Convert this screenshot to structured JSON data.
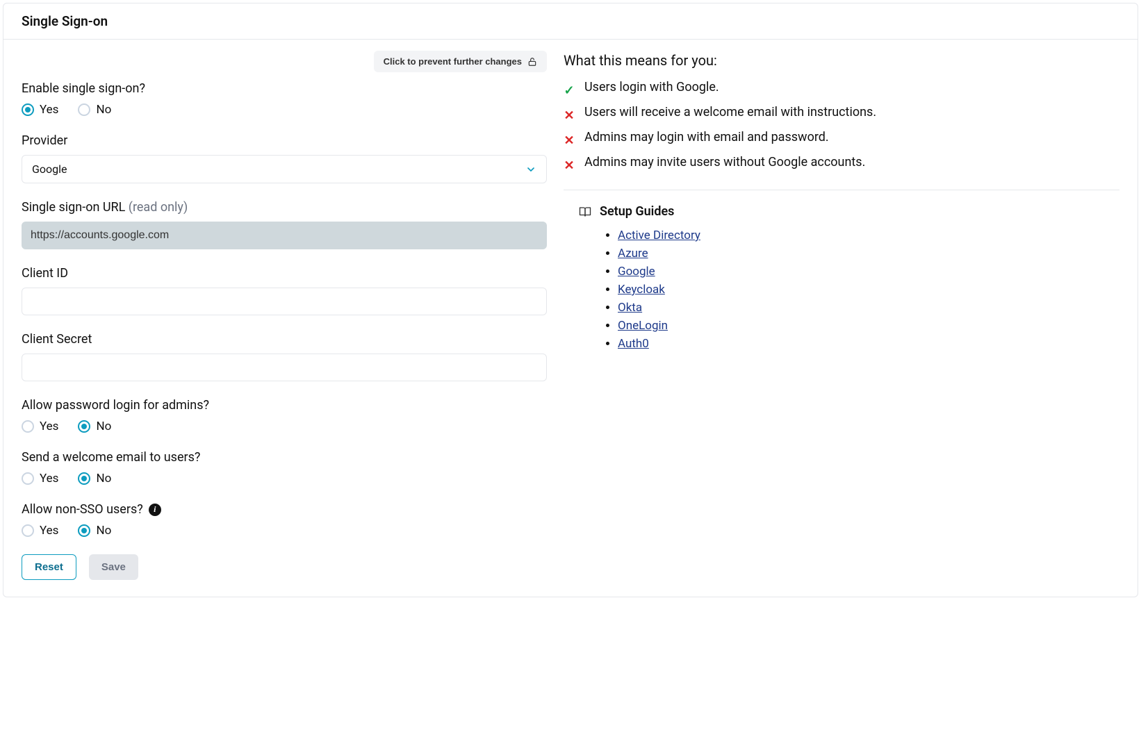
{
  "header": {
    "title": "Single Sign-on"
  },
  "lock_button": {
    "label": "Click to prevent further changes"
  },
  "form": {
    "enable": {
      "label": "Enable single sign-on?",
      "yes": "Yes",
      "no": "No",
      "selected": "yes"
    },
    "provider": {
      "label": "Provider",
      "value": "Google"
    },
    "sso_url": {
      "label": "Single sign-on URL ",
      "hint": "(read only)",
      "value": "https://accounts.google.com"
    },
    "client_id": {
      "label": "Client ID",
      "value": ""
    },
    "client_secret": {
      "label": "Client Secret",
      "value": ""
    },
    "allow_password_admins": {
      "label": "Allow password login for admins?",
      "yes": "Yes",
      "no": "No",
      "selected": "no"
    },
    "welcome_email": {
      "label": "Send a welcome email to users?",
      "yes": "Yes",
      "no": "No",
      "selected": "no"
    },
    "allow_non_sso": {
      "label": "Allow non-SSO users?",
      "yes": "Yes",
      "no": "No",
      "selected": "no"
    },
    "buttons": {
      "reset": "Reset",
      "save": "Save"
    }
  },
  "meaning": {
    "title": "What this means for you:",
    "items": [
      {
        "ok": true,
        "text": "Users login with Google."
      },
      {
        "ok": false,
        "text": "Users will receive a welcome email with instructions."
      },
      {
        "ok": false,
        "text": "Admins may login with email and password."
      },
      {
        "ok": false,
        "text": "Admins may invite users without Google accounts."
      }
    ]
  },
  "guides": {
    "title": "Setup Guides",
    "links": [
      "Active Directory",
      "Azure",
      "Google",
      "Keycloak",
      "Okta",
      "OneLogin",
      "Auth0"
    ]
  }
}
